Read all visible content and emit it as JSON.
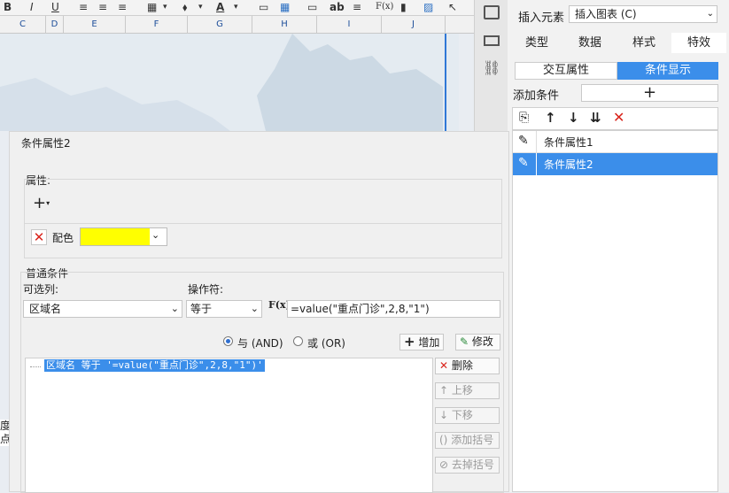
{
  "toolbar": {
    "items": [
      "B",
      "I",
      "U",
      "≡",
      "≡",
      "≡",
      "▦",
      "⬧",
      "A",
      "▭",
      "▦",
      "▭",
      "ab",
      "≡",
      "F(x)",
      "▮",
      "▨",
      "↖"
    ]
  },
  "sheet": {
    "columns": [
      "C",
      "D",
      "E",
      "F",
      "G",
      "H",
      "I",
      "J"
    ],
    "bottom_labels": [
      "度",
      "点"
    ]
  },
  "right_panel": {
    "insert_label": "插入元素",
    "insert_value": "插入图表 (C)",
    "tabs": [
      "类型",
      "数据",
      "样式",
      "特效"
    ],
    "subtabs": [
      "交互属性",
      "条件显示"
    ],
    "add_condition_label": "添加条件",
    "add_icon": "+",
    "list": [
      {
        "label": "条件属性1",
        "selected": false
      },
      {
        "label": "条件属性2",
        "selected": true
      }
    ]
  },
  "dialog": {
    "title": "条件属性2",
    "property_section": "属性:",
    "add_icon": "+",
    "color_label": "配色",
    "color_value": "#ffff00",
    "normal_condition": "普通条件",
    "optional_column_label": "可选列:",
    "operator_label": "操作符:",
    "column_value": "区域名",
    "operator_value": "等于",
    "fx_label": "F(x)",
    "formula_value": "=value(\"重点门诊\",2,8,\"1\")",
    "and_label": "与 (AND)",
    "or_label": "或 (OR)",
    "add_button": "增加",
    "modify_button": "修改",
    "condition_text": "区域名 等于 '=value(\"重点门诊\",2,8,\"1\")'",
    "side_buttons": [
      "删除",
      "上移",
      "下移",
      "添加括号",
      "去掉括号"
    ]
  },
  "colors": {
    "accent": "#3b8eea",
    "delete_red": "#d9241c"
  }
}
